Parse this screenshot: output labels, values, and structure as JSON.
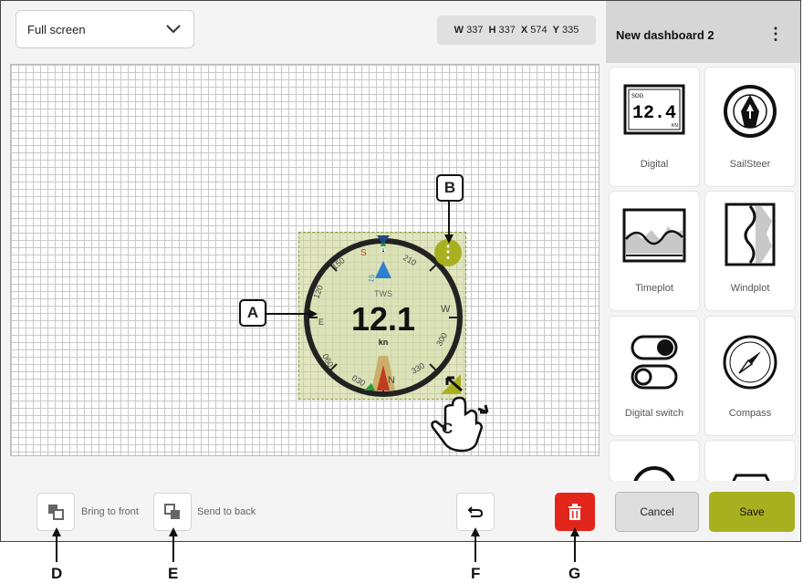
{
  "toolbar": {
    "dropdown_value": "Full screen"
  },
  "geometry": {
    "w_label": "W",
    "w_value": "337",
    "h_label": "H",
    "h_value": "337",
    "x_label": "X",
    "x_value": "574",
    "y_label": "Y",
    "y_value": "335"
  },
  "gauge": {
    "value": "12.1",
    "unit": "kn",
    "metric": "TWS",
    "speed_label": "15",
    "scale_labels": [
      "150",
      "120",
      "E",
      "060",
      "030",
      "N",
      "330",
      "300",
      "W",
      "210",
      "S"
    ],
    "pointer_label": "A",
    "colors": {
      "ring": "#222222",
      "pointer": "#2f7fd0",
      "port": "#c23b1f",
      "starboard": "#2d9b3a"
    }
  },
  "widget_menu_glyph": "⋮",
  "callouts": {
    "a": "A",
    "b": "B",
    "c": "C",
    "d": "D",
    "e": "E",
    "f": "F",
    "g": "G"
  },
  "bottom": {
    "bring_front": "Bring to front",
    "send_back": "Send to back"
  },
  "panel": {
    "title": "New dashboard 2",
    "menu_glyph": "⋮",
    "digital_preview": {
      "label": "SOG",
      "value": "12.4",
      "unit": "KN"
    },
    "tiles": [
      {
        "label": "Digital",
        "icon": "digital-readout-icon"
      },
      {
        "label": "SailSteer",
        "icon": "sailsteer-icon"
      },
      {
        "label": "Timeplot",
        "icon": "timeplot-icon"
      },
      {
        "label": "Windplot",
        "icon": "windplot-icon"
      },
      {
        "label": "Digital switch",
        "icon": "toggle-switch-icon"
      },
      {
        "label": "Compass",
        "icon": "compass-icon"
      }
    ],
    "cancel": "Cancel",
    "save": "Save"
  },
  "accent": "#a8b020",
  "danger": "#e2261c"
}
